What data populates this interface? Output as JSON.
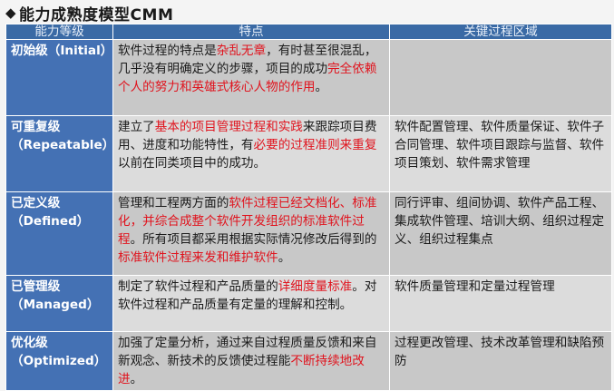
{
  "title": {
    "bullet": "◆",
    "text": "能力成熟度模型CMM"
  },
  "headers": {
    "level": "能力等级",
    "features": "特点",
    "areas": "关键过程区域"
  },
  "rows": [
    {
      "level": "初始级（Initial）",
      "features": [
        {
          "t": "软件过程的特点是",
          "red": false
        },
        {
          "t": "杂乱无章",
          "red": true
        },
        {
          "t": "，有时甚至很混乱，几乎没有明确定义的步骤，项目的成功",
          "red": false
        },
        {
          "t": "完全依赖个人的努力和英雄式核心人物的作用",
          "red": true
        },
        {
          "t": "。",
          "red": false
        }
      ],
      "areas": ""
    },
    {
      "level": "可重复级（Repeatable）",
      "features": [
        {
          "t": "建立了",
          "red": false
        },
        {
          "t": "基本的项目管理过程和实践",
          "red": true
        },
        {
          "t": "来跟踪项目费用、进度和功能特性，有",
          "red": false
        },
        {
          "t": "必要的过程准则来重复",
          "red": true
        },
        {
          "t": "以前在同类项目中的成功。",
          "red": false
        }
      ],
      "areas": "软件配置管理、软件质量保证、软件子合同管理、软件项目跟踪与监督、软件项目策划、软件需求管理"
    },
    {
      "level": "已定义级（Defined）",
      "features": [
        {
          "t": "管理和工程两方面的",
          "red": false
        },
        {
          "t": "软件过程已经文档化、标准化，并综合成整个软件开发组织的标准软件过程",
          "red": true
        },
        {
          "t": "。所有项目都采用根据实际情况修改后得到的",
          "red": false
        },
        {
          "t": "标准软件过程来发和维护软件",
          "red": true
        },
        {
          "t": "。",
          "red": false
        }
      ],
      "areas": "同行评审、组间协调、软件产品工程、集成软件管理、培训大纲、组织过程定义、组织过程集点"
    },
    {
      "level": "已管理级（Managed）",
      "features": [
        {
          "t": "制定了软件过程和产品质量的",
          "red": false
        },
        {
          "t": "详细度量标准",
          "red": true
        },
        {
          "t": "。对软件过程和产品质量有定量的理解和控制。",
          "red": false
        }
      ],
      "areas": "软件质量管理和定量过程管理"
    },
    {
      "level": "优化级（Optimized）",
      "features": [
        {
          "t": "加强了定量分析，通过来自过程质量反馈和来自新观念、新技术的反馈使过程能",
          "red": false
        },
        {
          "t": "不断持续地改进",
          "red": true
        },
        {
          "t": "。",
          "red": false
        }
      ],
      "areas": "过程更改管理、技术改革管理和缺陷预防"
    }
  ]
}
